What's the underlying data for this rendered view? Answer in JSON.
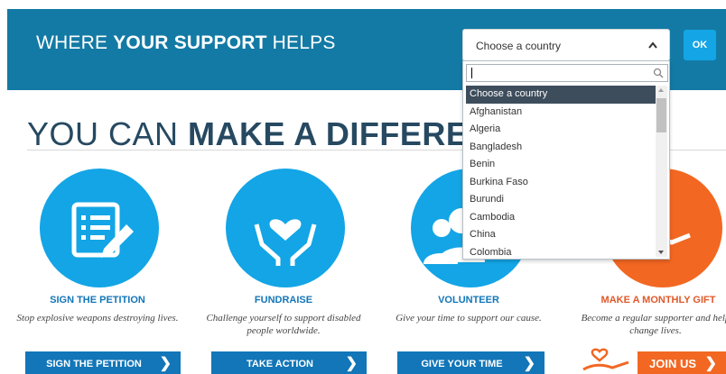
{
  "banner": {
    "title_prefix": "WHERE ",
    "title_bold": "YOUR SUPPORT",
    "title_suffix": " HELPS",
    "country_select": {
      "selected": "Choose a country"
    },
    "ok_label": "OK",
    "dropdown": {
      "search_value": "",
      "options": [
        "Choose a country",
        "Afghanistan",
        "Algeria",
        "Bangladesh",
        "Benin",
        "Burkina Faso",
        "Burundi",
        "Cambodia",
        "China",
        "Colombia"
      ],
      "highlighted": "Choose a country"
    }
  },
  "main": {
    "headline_prefix": "YOU CAN ",
    "headline_bold": "MAKE A DIFFERENC",
    "cards": [
      {
        "title": "SIGN THE PETITION",
        "description": "Stop explosive weapons destroying lives.",
        "button": "SIGN THE PETITION",
        "icon": "petition-form-icon"
      },
      {
        "title": "FUNDRAISE",
        "description": "Challenge yourself to support disabled people worldwide.",
        "button": "TAKE ACTION",
        "icon": "hands-heart-icon"
      },
      {
        "title": "VOLUNTEER",
        "description": "Give your time to support our cause.",
        "button": "GIVE YOUR TIME",
        "icon": "people-group-icon"
      },
      {
        "title": "MAKE A MONTHLY GIFT",
        "description": "Become a regular supporter and help change lives.",
        "button": "JOIN US",
        "icon": "hand-heart-icon"
      }
    ]
  },
  "colors": {
    "banner": "#137aa5",
    "accent_blue": "#13a5e6",
    "button_blue": "#1276b8",
    "accent_orange": "#f26722",
    "headline": "#264961"
  }
}
